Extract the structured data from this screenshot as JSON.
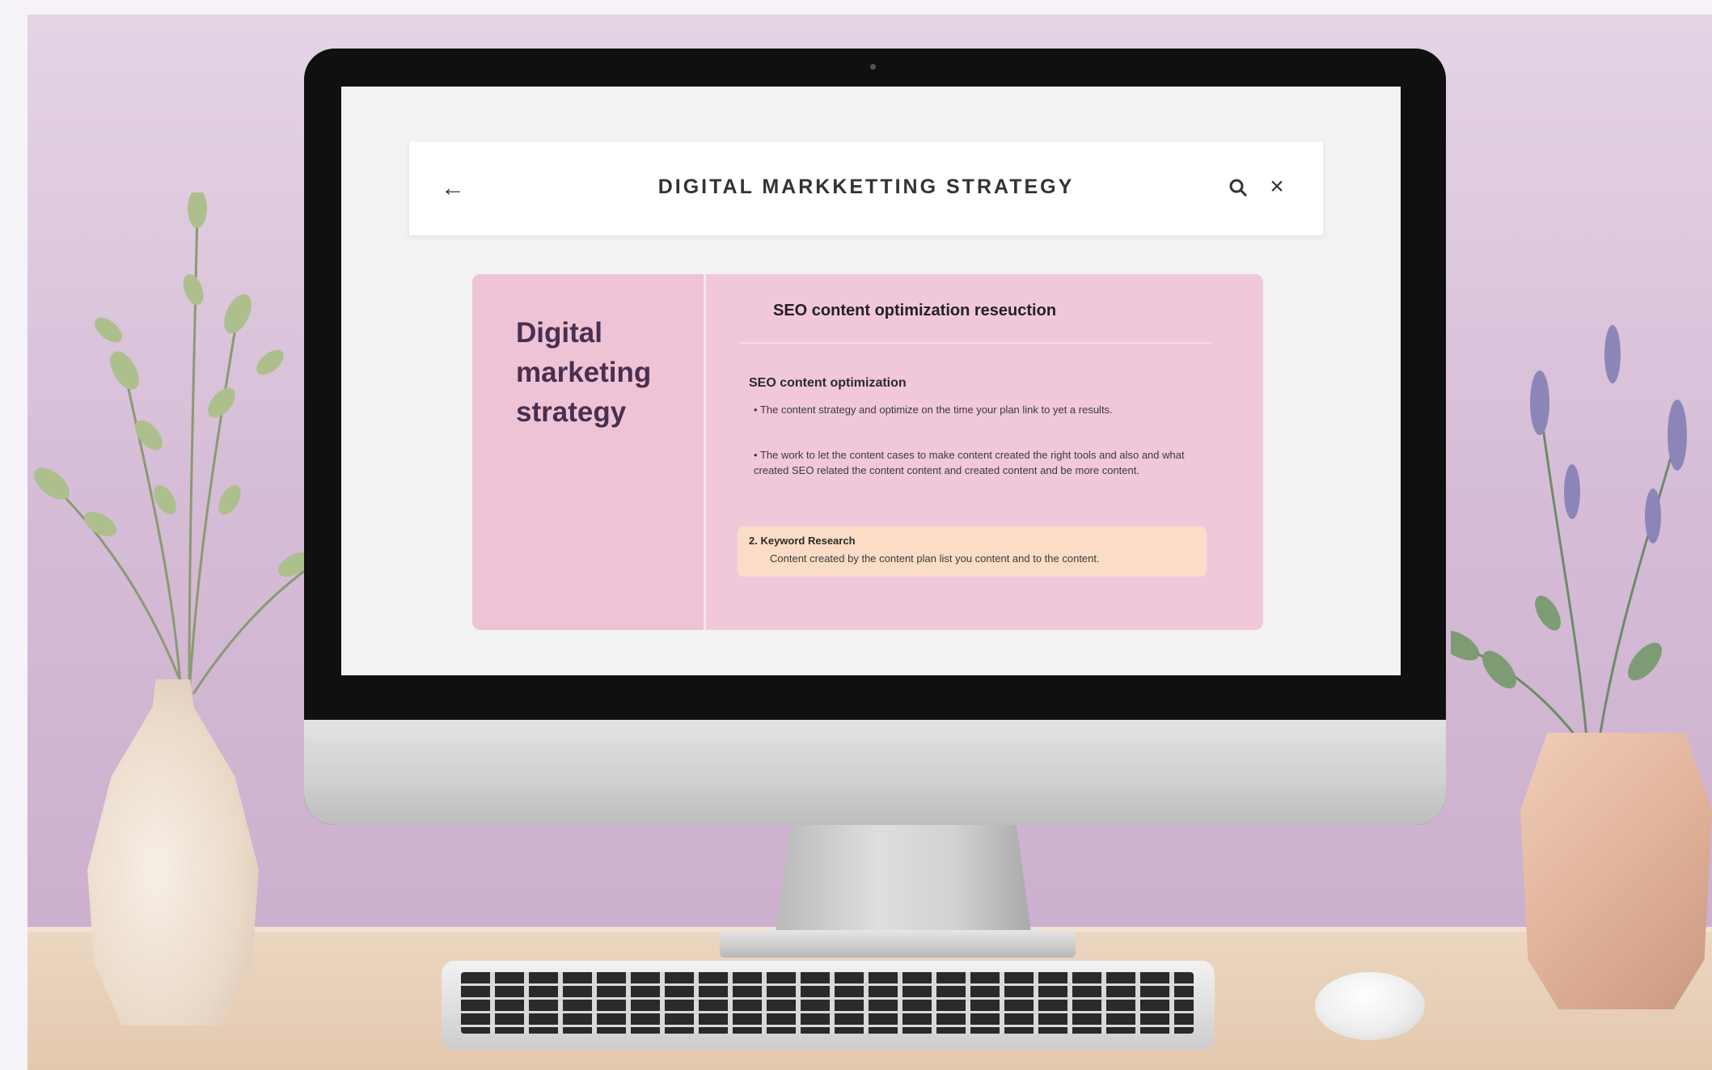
{
  "app": {
    "title": "DIGITAL MARKKETTING STRATEGY",
    "icons": {
      "back": "arrow-left-icon",
      "search": "search-icon",
      "close": "close-icon"
    }
  },
  "card": {
    "heading": "Digital marketing strategy",
    "section_title": "SEO content optimization reseuction",
    "subsection_title": "SEO content optimization",
    "bullets": [
      "The content strategy and optimize on the time your plan link to yet a results.",
      "The work to let the content cases to make content created the right tools and also and what created SEO related the content content and created content and be more content."
    ],
    "callout": {
      "title": "2. Keyword Research",
      "text": "Content created by the content plan list you content and to the content."
    }
  },
  "colors": {
    "background": "#d6bdd7",
    "card": "#f1c8da",
    "callout": "#fbdcc6",
    "heading": "#4a2f4f"
  }
}
